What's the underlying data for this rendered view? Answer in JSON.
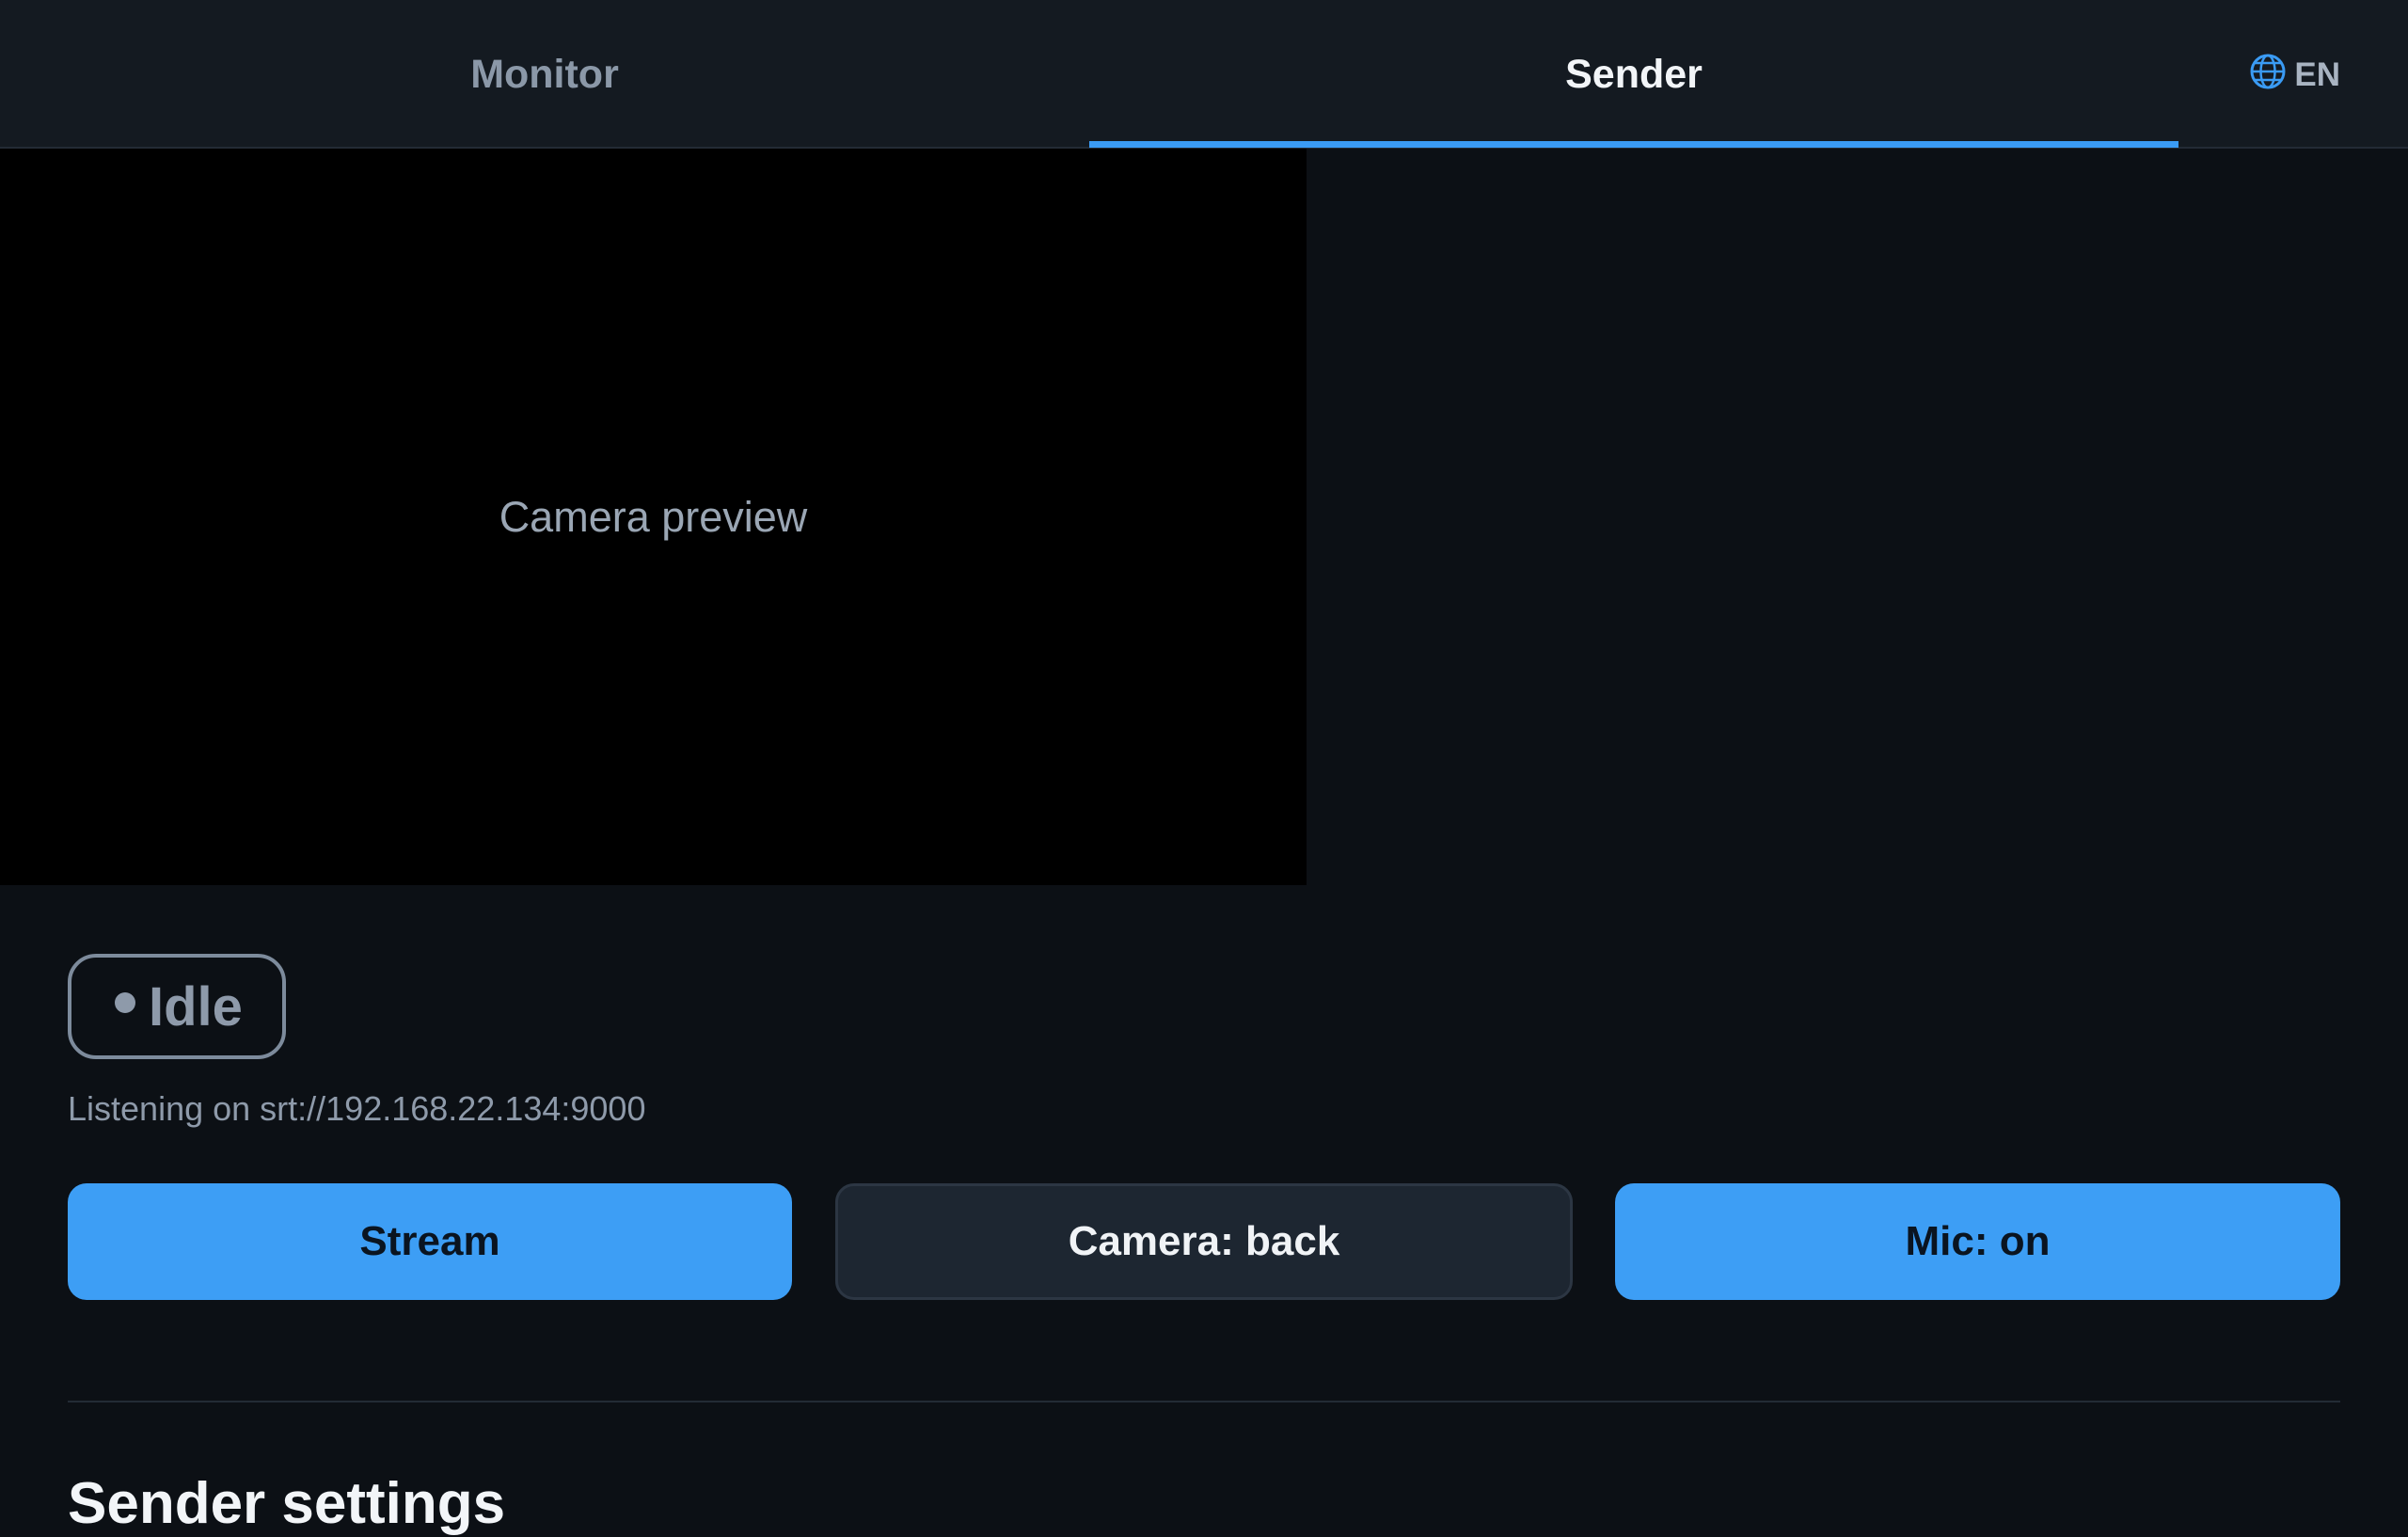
{
  "tabs": [
    {
      "label": "Monitor",
      "active": false
    },
    {
      "label": "Sender",
      "active": true
    }
  ],
  "language": {
    "icon": "globe-icon",
    "label": "EN"
  },
  "preview": {
    "label": "Camera preview"
  },
  "status": {
    "label": "Idle"
  },
  "listening": "Listening on srt://192.168.22.134:9000",
  "buttons": {
    "stream": "Stream",
    "camera": "Camera: back",
    "mic": "Mic: on"
  },
  "settings": {
    "heading": "Sender settings"
  },
  "colors": {
    "accent": "#3a9bf4",
    "background": "#0c1015",
    "topbar": "#141a21",
    "muted": "#8e9aaa"
  }
}
